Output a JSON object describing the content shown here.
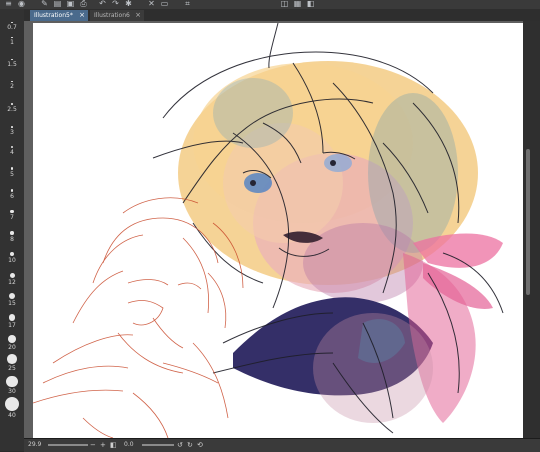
{
  "toolbar": {
    "icons": [
      "menu-icon",
      "camera-icon",
      "pen-icon",
      "folder-icon",
      "save-icon",
      "print-icon",
      "undo-icon",
      "redo-icon",
      "loading-icon",
      "delete-icon",
      "clear-icon",
      "crop-icon",
      "transform-icon",
      "grid-icon",
      "layer-icon"
    ]
  },
  "brush_sizes": [
    "0.7",
    "1",
    "1.5",
    "2",
    "2.5",
    "3",
    "4",
    "5",
    "6",
    "7",
    "8",
    "10",
    "12",
    "15",
    "17",
    "20",
    "25",
    "30",
    "40"
  ],
  "tabs": [
    {
      "label": "Illustration5*",
      "active": true
    },
    {
      "label": "Illustration6",
      "active": false
    }
  ],
  "status": {
    "zoom": "29.9",
    "angle": "0.0"
  },
  "colors": {
    "sketch_red": "#c8482a",
    "hair": "#f0c978",
    "navy": "#2a2460",
    "ribbon": "#e0508a"
  }
}
